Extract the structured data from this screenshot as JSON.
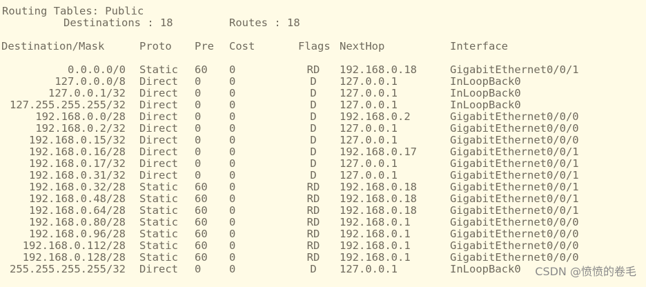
{
  "title": "Routing Tables: Public",
  "destinations_label": "Destinations : 18",
  "routes_label": "Routes : 18",
  "headers": {
    "destination": "Destination/Mask",
    "proto": "Proto",
    "pre": "Pre",
    "cost": "Cost",
    "flags": "Flags",
    "nexthop": "NextHop",
    "interface": "Interface"
  },
  "rows": [
    {
      "destination": "0.0.0.0/0",
      "proto": "Static",
      "pre": "60",
      "cost": "0",
      "flags": "RD",
      "nexthop": "192.168.0.18",
      "interface": "GigabitEthernet0/0/1"
    },
    {
      "destination": "127.0.0.0/8",
      "proto": "Direct",
      "pre": "0",
      "cost": "0",
      "flags": "D",
      "nexthop": "127.0.0.1",
      "interface": "InLoopBack0"
    },
    {
      "destination": "127.0.0.1/32",
      "proto": "Direct",
      "pre": "0",
      "cost": "0",
      "flags": "D",
      "nexthop": "127.0.0.1",
      "interface": "InLoopBack0"
    },
    {
      "destination": "127.255.255.255/32",
      "proto": "Direct",
      "pre": "0",
      "cost": "0",
      "flags": "D",
      "nexthop": "127.0.0.1",
      "interface": "InLoopBack0"
    },
    {
      "destination": "192.168.0.0/28",
      "proto": "Direct",
      "pre": "0",
      "cost": "0",
      "flags": "D",
      "nexthop": "192.168.0.2",
      "interface": "GigabitEthernet0/0/0"
    },
    {
      "destination": "192.168.0.2/32",
      "proto": "Direct",
      "pre": "0",
      "cost": "0",
      "flags": "D",
      "nexthop": "127.0.0.1",
      "interface": "GigabitEthernet0/0/0"
    },
    {
      "destination": "192.168.0.15/32",
      "proto": "Direct",
      "pre": "0",
      "cost": "0",
      "flags": "D",
      "nexthop": "127.0.0.1",
      "interface": "GigabitEthernet0/0/0"
    },
    {
      "destination": "192.168.0.16/28",
      "proto": "Direct",
      "pre": "0",
      "cost": "0",
      "flags": "D",
      "nexthop": "192.168.0.17",
      "interface": "GigabitEthernet0/0/1"
    },
    {
      "destination": "192.168.0.17/32",
      "proto": "Direct",
      "pre": "0",
      "cost": "0",
      "flags": "D",
      "nexthop": "127.0.0.1",
      "interface": "GigabitEthernet0/0/1"
    },
    {
      "destination": "192.168.0.31/32",
      "proto": "Direct",
      "pre": "0",
      "cost": "0",
      "flags": "D",
      "nexthop": "127.0.0.1",
      "interface": "GigabitEthernet0/0/1"
    },
    {
      "destination": "192.168.0.32/28",
      "proto": "Static",
      "pre": "60",
      "cost": "0",
      "flags": "RD",
      "nexthop": "192.168.0.18",
      "interface": "GigabitEthernet0/0/1"
    },
    {
      "destination": "192.168.0.48/28",
      "proto": "Static",
      "pre": "60",
      "cost": "0",
      "flags": "RD",
      "nexthop": "192.168.0.18",
      "interface": "GigabitEthernet0/0/1"
    },
    {
      "destination": "192.168.0.64/28",
      "proto": "Static",
      "pre": "60",
      "cost": "0",
      "flags": "RD",
      "nexthop": "192.168.0.18",
      "interface": "GigabitEthernet0/0/1"
    },
    {
      "destination": "192.168.0.80/28",
      "proto": "Static",
      "pre": "60",
      "cost": "0",
      "flags": "RD",
      "nexthop": "192.168.0.1",
      "interface": "GigabitEthernet0/0/0"
    },
    {
      "destination": "192.168.0.96/28",
      "proto": "Static",
      "pre": "60",
      "cost": "0",
      "flags": "RD",
      "nexthop": "192.168.0.1",
      "interface": "GigabitEthernet0/0/0"
    },
    {
      "destination": "192.168.0.112/28",
      "proto": "Static",
      "pre": "60",
      "cost": "0",
      "flags": "RD",
      "nexthop": "192.168.0.1",
      "interface": "GigabitEthernet0/0/0"
    },
    {
      "destination": "192.168.0.128/28",
      "proto": "Static",
      "pre": "60",
      "cost": "0",
      "flags": "RD",
      "nexthop": "192.168.0.1",
      "interface": "GigabitEthernet0/0/0"
    },
    {
      "destination": "255.255.255.255/32",
      "proto": "Direct",
      "pre": "0",
      "cost": "0",
      "flags": "D",
      "nexthop": "127.0.0.1",
      "interface": "InLoopBack0"
    }
  ],
  "watermark": "CSDN @愤愤的卷毛"
}
